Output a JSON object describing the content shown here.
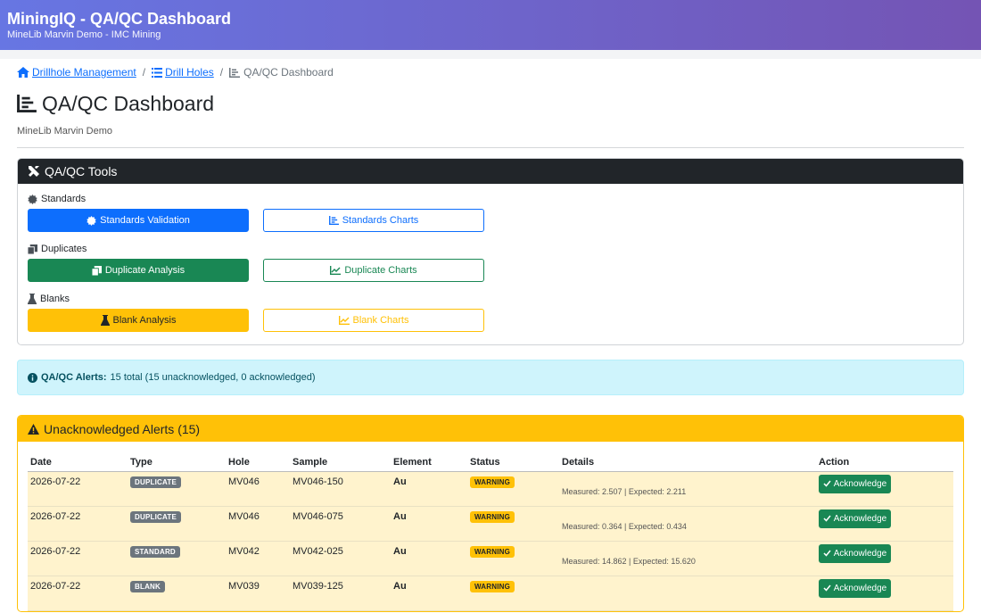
{
  "header": {
    "title": "MiningIQ - QA/QC Dashboard",
    "subtitle": "MineLib Marvin Demo - IMC Mining"
  },
  "breadcrumb": {
    "item1": "Drillhole Management",
    "item2": "Drill Holes",
    "current": "QA/QC Dashboard"
  },
  "page": {
    "title": "QA/QC Dashboard",
    "subtitle": "MineLib Marvin Demo"
  },
  "tools": {
    "header": "QA/QC Tools",
    "standards": {
      "label": "Standards",
      "primary": "Standards Validation",
      "charts": "Standards Charts"
    },
    "duplicates": {
      "label": "Duplicates",
      "primary": "Duplicate Analysis",
      "charts": "Duplicate Charts"
    },
    "blanks": {
      "label": "Blanks",
      "primary": "Blank Analysis",
      "charts": "Blank Charts"
    }
  },
  "info_alert": {
    "label": "QA/QC Alerts:",
    "text": "15 total (15 unacknowledged, 0 acknowledged)"
  },
  "alerts": {
    "header": "Unacknowledged Alerts (15)",
    "columns": [
      "Date",
      "Type",
      "Hole",
      "Sample",
      "Element",
      "Status",
      "Details",
      "Action"
    ],
    "rows": [
      {
        "date": "2026-07-22",
        "type": "DUPLICATE",
        "hole": "MV046",
        "sample": "MV046-150",
        "element": "Au",
        "status": "WARNING",
        "details": "Measured: 2.507 | Expected: 2.211",
        "action": "Acknowledge"
      },
      {
        "date": "2026-07-22",
        "type": "DUPLICATE",
        "hole": "MV046",
        "sample": "MV046-075",
        "element": "Au",
        "status": "WARNING",
        "details": "Measured: 0.364 | Expected: 0.434",
        "action": "Acknowledge"
      },
      {
        "date": "2026-07-22",
        "type": "STANDARD",
        "hole": "MV042",
        "sample": "MV042-025",
        "element": "Au",
        "status": "WARNING",
        "details": "Measured: 14.862 | Expected: 15.620",
        "action": "Acknowledge"
      },
      {
        "date": "2026-07-22",
        "type": "BLANK",
        "hole": "MV039",
        "sample": "MV039-125",
        "element": "Au",
        "status": "WARNING",
        "details": "",
        "action": "Acknowledge"
      }
    ]
  },
  "colors": {
    "primary": "#0d6efd",
    "success": "#198754",
    "warning": "#ffc107",
    "dark": "#212529",
    "info_bg": "#cff4fc",
    "row_bg": "#fff3cd"
  }
}
